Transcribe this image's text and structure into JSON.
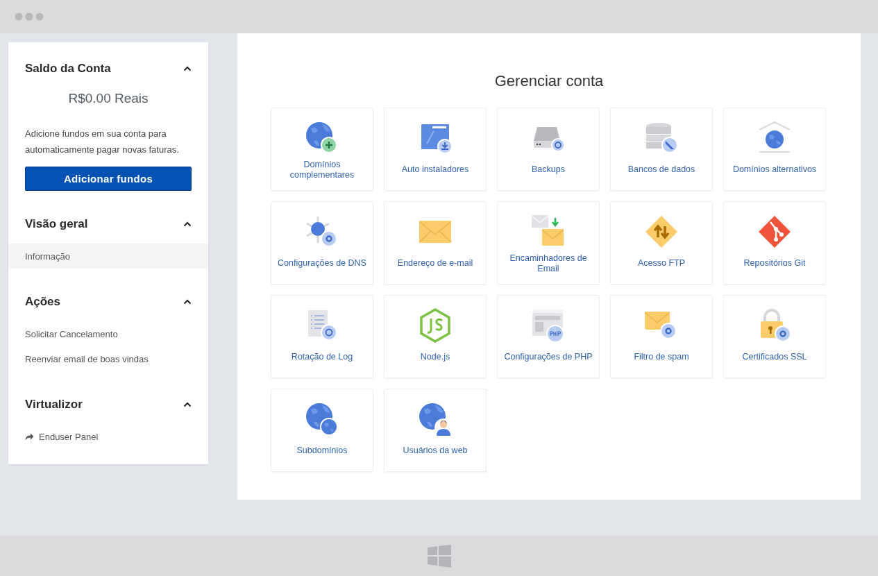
{
  "sidebar": {
    "sections": [
      {
        "title": "Saldo da Conta",
        "expanded": true,
        "balance": "R$0.00 Reais",
        "note": "Adicione fundos em sua conta para automaticamente pagar novas faturas.",
        "button": "Adicionar fundos"
      },
      {
        "title": "Visão geral",
        "expanded": true,
        "items": [
          {
            "label": "Informação",
            "selected": true,
            "kind": "plain"
          }
        ]
      },
      {
        "title": "Ações",
        "expanded": true,
        "items": [
          {
            "label": "Solicitar Cancelamento",
            "selected": false,
            "kind": "plain"
          },
          {
            "label": "Reenviar email de boas vindas",
            "selected": false,
            "kind": "plain"
          }
        ]
      },
      {
        "title": "Virtualizor",
        "expanded": true,
        "items": [
          {
            "label": "Enduser Panel",
            "selected": false,
            "kind": "share"
          }
        ]
      }
    ]
  },
  "main": {
    "title": "Gerenciar conta",
    "tiles": [
      {
        "label": "Domínios complementares",
        "kind": "globe-plus"
      },
      {
        "label": "Auto instaladores",
        "kind": "installer"
      },
      {
        "label": "Backups",
        "kind": "drive"
      },
      {
        "label": "Bancos de dados",
        "kind": "database"
      },
      {
        "label": "Domínios alternativos",
        "kind": "globe-house"
      },
      {
        "label": "Configurações de DNS",
        "kind": "dns"
      },
      {
        "label": "Endereço de e-mail",
        "kind": "envelope"
      },
      {
        "label": "Encaminhadores de Email",
        "kind": "forward"
      },
      {
        "label": "Acesso FTP",
        "kind": "ftp"
      },
      {
        "label": "Repositórios Git",
        "kind": "git"
      },
      {
        "label": "Rotação de Log",
        "kind": "log"
      },
      {
        "label": "Node.js",
        "kind": "nodejs"
      },
      {
        "label": "Configurações de PHP",
        "kind": "php"
      },
      {
        "label": "Filtro de spam",
        "kind": "spam"
      },
      {
        "label": "Certificados SSL",
        "kind": "lock"
      },
      {
        "label": "Subdomínios",
        "kind": "globes"
      },
      {
        "label": "Usuários da web",
        "kind": "globe-user"
      }
    ]
  }
}
